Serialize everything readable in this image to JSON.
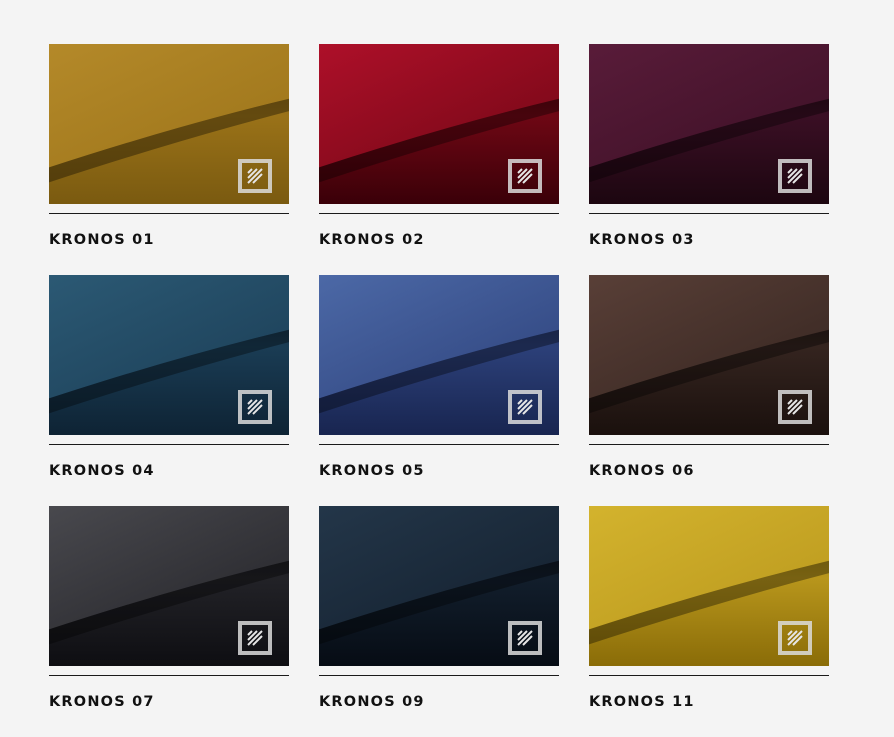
{
  "swatches": [
    {
      "name": "KRONOS 01",
      "color_light": "#b58a2a",
      "color_dark": "#7a5a10",
      "color_mid": "#9a7218",
      "badge_icon": "fabric-logo-icon"
    },
    {
      "name": "KRONOS 02",
      "color_light": "#b0102a",
      "color_dark": "#3a0008",
      "color_mid": "#6e0714",
      "badge_icon": "fabric-logo-icon"
    },
    {
      "name": "KRONOS 03",
      "color_light": "#5a1c3a",
      "color_dark": "#1c0610",
      "color_mid": "#3a0f24",
      "badge_icon": "fabric-logo-icon"
    },
    {
      "name": "KRONOS 04",
      "color_light": "#2c5a75",
      "color_dark": "#0e2334",
      "color_mid": "#1a3c54",
      "badge_icon": "fabric-logo-icon"
    },
    {
      "name": "KRONOS 05",
      "color_light": "#4d6aa8",
      "color_dark": "#182550",
      "color_mid": "#2c4079",
      "badge_icon": "fabric-logo-icon"
    },
    {
      "name": "KRONOS 06",
      "color_light": "#5a4038",
      "color_dark": "#1a100d",
      "color_mid": "#34241f",
      "badge_icon": "fabric-logo-icon"
    },
    {
      "name": "KRONOS 07",
      "color_light": "#4a4a4f",
      "color_dark": "#0e0e12",
      "color_mid": "#222227",
      "badge_icon": "fabric-logo-icon"
    },
    {
      "name": "KRONOS 09",
      "color_light": "#24374a",
      "color_dark": "#060c14",
      "color_mid": "#121e2c",
      "badge_icon": "fabric-logo-icon"
    },
    {
      "name": "KRONOS 11",
      "color_light": "#d4b42e",
      "color_dark": "#8a6c08",
      "color_mid": "#b8961c",
      "badge_icon": "fabric-logo-icon"
    }
  ]
}
